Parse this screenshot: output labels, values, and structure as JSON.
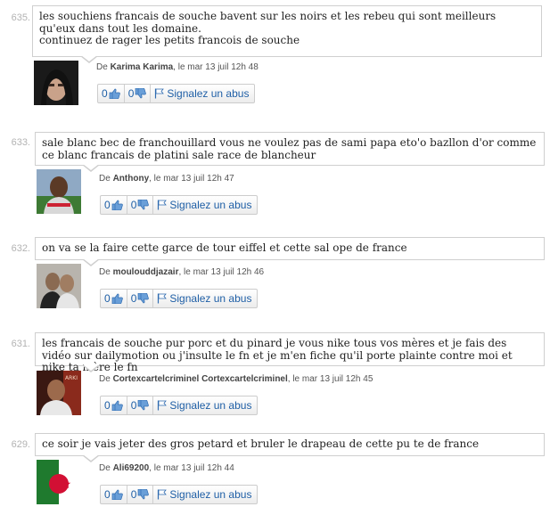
{
  "colors": {
    "link": "#1f5fa6",
    "number": "#b3b3b3",
    "bubble_border": "#cfcfcf"
  },
  "labels": {
    "by": "De",
    "report": "Signalez un abus"
  },
  "comments": [
    {
      "number": "635.",
      "text": [
        "les souchiens francais de souche bavent sur les noirs et les rebeu qui sont meilleurs qu'eux dans tout les domaine.",
        "continuez de rager les petits francois de souche"
      ],
      "author": "Karima Karima",
      "date": ", le mar 13 juil 12h 48",
      "likes": "0",
      "dislikes": "0",
      "avatar_icon": "person-photo"
    },
    {
      "number": "633.",
      "text": [
        "sale blanc bec de franchouillard vous ne voulez pas de sami papa eto'o bazllon d'or comme ce blanc francais de platini sale race de blancheur"
      ],
      "author": "Anthony",
      "date": ", le mar 13 juil 12h 47",
      "likes": "0",
      "dislikes": "0",
      "avatar_icon": "person-photo"
    },
    {
      "number": "632.",
      "text": [
        "on va se la faire cette garce de tour eiffel et cette sal ope de france"
      ],
      "author": "moulouddjazair",
      "date": ", le mar 13 juil 12h 46",
      "likes": "0",
      "dislikes": "0",
      "avatar_icon": "person-photo"
    },
    {
      "number": "631.",
      "text": [
        "les francais de souche pur porc et du pinard je vous nike tous vos mères et je fais des vidéo sur dailymotion ou j'insulte le fn et je m'en fiche qu'il porte plainte contre moi et nike ta mère le fn"
      ],
      "author": "Cortexcartelcriminel Cortexcartelcriminel",
      "date": ", le mar 13 juil 12h 45",
      "likes": "0",
      "dislikes": "0",
      "avatar_icon": "person-photo"
    },
    {
      "number": "629.",
      "text": [
        "ce soir je vais jeter des gros petard et bruler le drapeau de cette pu te de france"
      ],
      "author": "Ali69200",
      "date": ", le mar 13 juil 12h 44",
      "likes": "0",
      "dislikes": "0",
      "avatar_icon": "algeria-flag"
    }
  ]
}
